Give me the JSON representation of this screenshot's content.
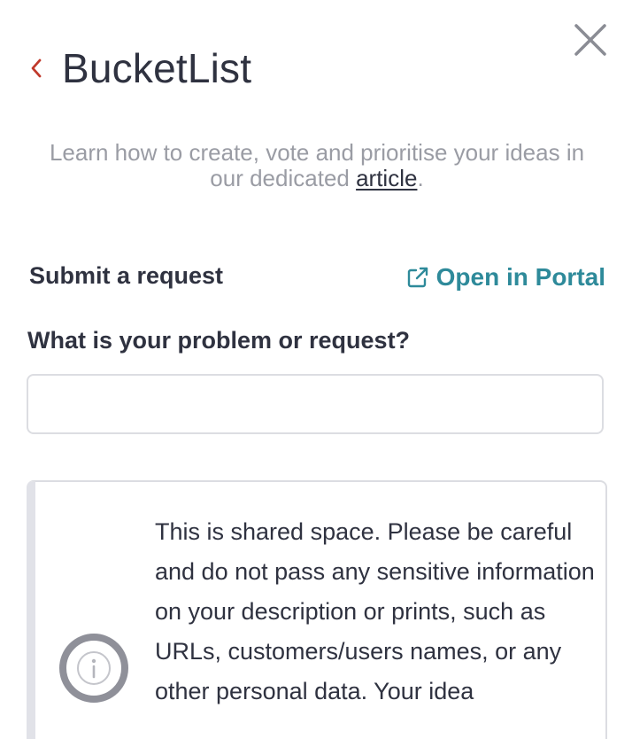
{
  "header": {
    "back_icon": "chevron-left-icon",
    "title": "BucketList",
    "close_icon": "close-icon"
  },
  "intro": {
    "text_before": "Learn how to create, vote and prioritise your ideas in our dedicated ",
    "link_text": "article",
    "text_after": "."
  },
  "submit": {
    "section_title": "Submit a request",
    "portal_link_label": "Open in Portal",
    "portal_icon": "external-link-icon"
  },
  "form": {
    "question_label": "What is your problem or request?",
    "question_value": "",
    "question_placeholder": ""
  },
  "notice": {
    "icon": "info-icon",
    "text": "This is shared space. Please be careful and do not pass any sensitive information on your description or prints, such as URLs, customers/users names, or any other personal data. Your idea"
  },
  "colors": {
    "accent": "#2e8a9a",
    "back_chevron": "#c0392b",
    "text_dark": "#2f3240",
    "text_muted": "#9a9ca4",
    "border": "#dcdde2"
  }
}
